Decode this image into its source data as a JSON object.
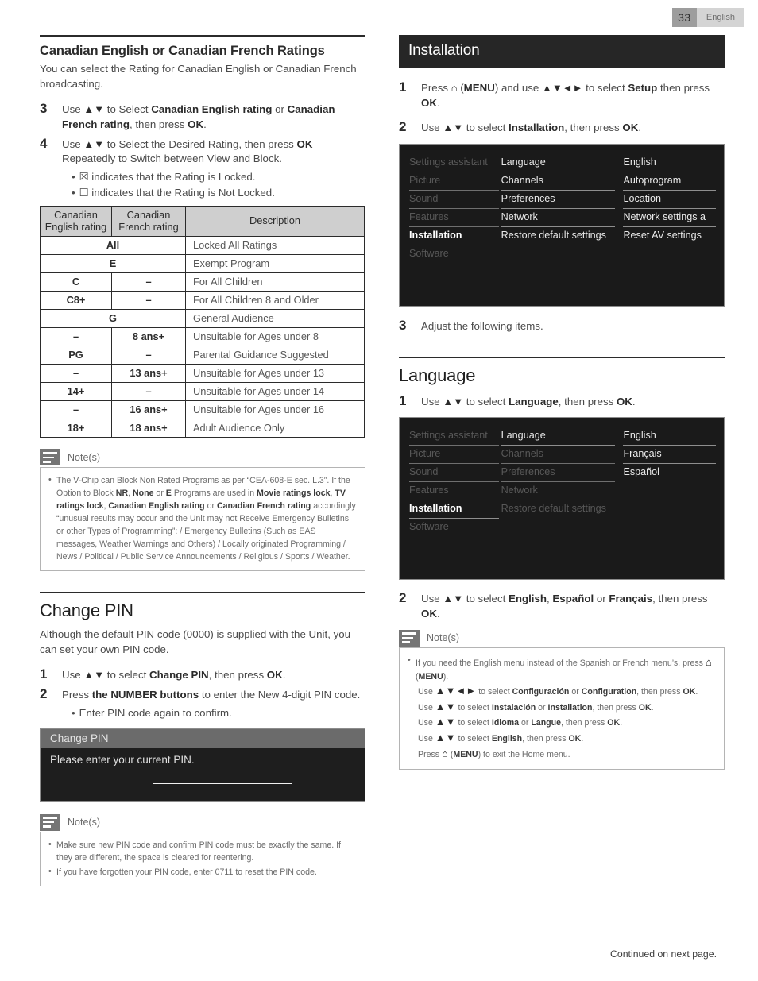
{
  "header": {
    "page_number": "33",
    "language": "English"
  },
  "footer": {
    "continued": "Continued on next page."
  },
  "left": {
    "section1": {
      "heading": "Canadian English or Canadian French Ratings",
      "intro": "You can select the Rating for Canadian English or Canadian French broadcasting.",
      "steps": [
        {
          "num": "3",
          "html": "Use <span class=\"glyph\">▲▼</span> to Select <b>Canadian English rating</b> or <b>Canadian French rating</b>, then press <b>OK</b>."
        },
        {
          "num": "4",
          "html": "Use <span class=\"glyph\">▲▼</span> to Select the Desired Rating, then press <b>OK</b> Repeatedly to Switch between View and Block."
        }
      ],
      "bullets": [
        "☒ indicates that the Rating is Locked.",
        "☐ indicates that the Rating is Not Locked."
      ]
    },
    "table": {
      "headers": [
        "Canadian English rating",
        "Canadian French rating",
        "Description"
      ],
      "rows": [
        {
          "span": true,
          "rating": "All",
          "desc": "Locked All Ratings"
        },
        {
          "span": true,
          "rating": "E",
          "desc": "Exempt Program"
        },
        {
          "span": false,
          "english": "C",
          "french": "–",
          "desc": "For All Children"
        },
        {
          "span": false,
          "english": "C8+",
          "french": "–",
          "desc": "For All Children 8 and Older"
        },
        {
          "span": true,
          "rating": "G",
          "desc": "General Audience"
        },
        {
          "span": false,
          "english": "–",
          "french": "8 ans+",
          "desc": "Unsuitable for Ages under 8"
        },
        {
          "span": false,
          "english": "PG",
          "french": "–",
          "desc": "Parental Guidance Suggested"
        },
        {
          "span": false,
          "english": "–",
          "french": "13 ans+",
          "desc": "Unsuitable for Ages under 13"
        },
        {
          "span": false,
          "english": "14+",
          "french": "–",
          "desc": "Unsuitable for Ages under 14"
        },
        {
          "span": false,
          "english": "–",
          "french": "16 ans+",
          "desc": "Unsuitable for Ages under 16"
        },
        {
          "span": false,
          "english": "18+",
          "french": "18 ans+",
          "desc": "Adult Audience Only"
        }
      ]
    },
    "notes1": {
      "title": "Note(s)",
      "items_html": [
        "The V-Chip can Block Non Rated Programs as per “CEA-608-E sec. L.3”. If the Option to Block <b>NR</b>, <b>None</b> or <b>E</b> Programs are used in <b>Movie ratings lock</b>, <b>TV ratings lock</b>, <b>Canadian English rating</b> or <b>Canadian French rating</b> accordingly “unusual results may occur and the Unit may not Receive Emergency Bulletins or other Types of Programming”: / Emergency Bulletins (Such as EAS messages, Weather Warnings and Others) / Locally originated Programming / News / Political / Public Service Announcements / Religious / Sports / Weather."
      ]
    },
    "section2": {
      "heading": "Change PIN",
      "intro": "Although the default PIN code (0000) is supplied with the Unit, you can set your own PIN code.",
      "steps": [
        {
          "num": "1",
          "html": "Use <span class=\"glyph\">▲▼</span> to select <b>Change PIN</b>, then press <b>OK</b>."
        },
        {
          "num": "2",
          "html": "Press <b>the NUMBER buttons</b> to enter the New 4-digit PIN code."
        }
      ],
      "bullets": [
        "Enter PIN code again to confirm."
      ]
    },
    "pin_dialog": {
      "title": "Change PIN",
      "prompt": "Please enter your current PIN.",
      "field_value": ""
    },
    "notes2": {
      "title": "Note(s)",
      "items_html": [
        "Make sure new PIN code and confirm PIN code must be exactly the same. If they are different, the space is cleared for reentering.",
        "If you have forgotten your PIN code, enter 0711 to reset the PIN code."
      ]
    }
  },
  "right": {
    "banner": "Installation",
    "steps": [
      {
        "num": "1",
        "html": "Press <span class=\"home\">⌂</span> (<b>MENU</b>) and use <span class=\"glyph\">▲▼◄►</span> to select <b>Setup</b> then press <b>OK</b>."
      },
      {
        "num": "2",
        "html": "Use <span class=\"glyph\">▲▼</span> to select <b>Installation</b>, then press <b>OK</b>."
      }
    ],
    "menu1": {
      "col1": [
        {
          "label": "Settings assistant",
          "state": "dim"
        },
        {
          "label": "Picture",
          "state": "dim"
        },
        {
          "label": "Sound",
          "state": "dim"
        },
        {
          "label": "Features",
          "state": "dim"
        },
        {
          "label": "Installation",
          "state": "selected"
        },
        {
          "label": "Software",
          "state": "dim-noline"
        }
      ],
      "col2": [
        {
          "label": "Language",
          "state": "bright"
        },
        {
          "label": "Channels",
          "state": "bright"
        },
        {
          "label": "Preferences",
          "state": "bright"
        },
        {
          "label": "Network",
          "state": "bright"
        },
        {
          "label": "Restore default settings",
          "state": "bright-noline"
        }
      ],
      "col3": [
        {
          "label": "English",
          "state": "bright"
        },
        {
          "label": "Autoprogram",
          "state": "bright"
        },
        {
          "label": "Location",
          "state": "bright"
        },
        {
          "label": "Network settings a",
          "state": "bright"
        },
        {
          "label": "Reset AV settings",
          "state": "bright-noline"
        }
      ]
    },
    "step3": {
      "num": "3",
      "html": "Adjust the following items."
    },
    "language_heading": "Language",
    "lang_steps": [
      {
        "num": "1",
        "html": "Use <span class=\"glyph\">▲▼</span> to select <b>Language</b>, then press <b>OK</b>."
      }
    ],
    "menu2": {
      "col1": [
        {
          "label": "Settings assistant",
          "state": "dim"
        },
        {
          "label": "Picture",
          "state": "dim"
        },
        {
          "label": "Sound",
          "state": "dim"
        },
        {
          "label": "Features",
          "state": "dim"
        },
        {
          "label": "Installation",
          "state": "selected"
        },
        {
          "label": "Software",
          "state": "dim-noline"
        }
      ],
      "col2": [
        {
          "label": "Language",
          "state": "bright"
        },
        {
          "label": "Channels",
          "state": "dim"
        },
        {
          "label": "Preferences",
          "state": "dim"
        },
        {
          "label": "Network",
          "state": "dim"
        },
        {
          "label": "Restore default settings",
          "state": "dim-noline"
        }
      ],
      "col3": [
        {
          "label": "English",
          "state": "bright"
        },
        {
          "label": "Français",
          "state": "bright"
        },
        {
          "label": "Español",
          "state": "bright-noline"
        }
      ]
    },
    "lang_step2": {
      "num": "2",
      "html": "Use <span class=\"glyph\">▲▼</span> to select <b>English</b>, <b>Español</b> or <b>Français</b>, then press <b>OK</b>."
    },
    "notes": {
      "title": "Note(s)",
      "items_html": [
        "If you need the English menu instead of the Spanish or French menu’s, press <span class=\"home\">⌂</span> (<b>MENU</b>).<span class=\"note-sub\">Use <span class=\"glyph\">▲▼◄►</span> to select <b>Configuración</b> or <b>Configuration</b>, then press <b>OK</b>.</span><span class=\"note-sub\">Use <span class=\"glyph\">▲▼</span> to select <b>Instalación</b> or <b>Installation</b>, then press <b>OK</b>.</span><span class=\"note-sub\">Use <span class=\"glyph\">▲▼</span> to select <b>Idioma</b> or <b>Langue</b>, then press <b>OK</b>.</span><span class=\"note-sub\">Use <span class=\"glyph\">▲▼</span> to select <b>English</b>, then press <b>OK</b>.</span><span class=\"note-sub\">Press <span class=\"home\">⌂</span> (<b>MENU</b>) to exit the Home menu.</span>"
      ]
    }
  }
}
